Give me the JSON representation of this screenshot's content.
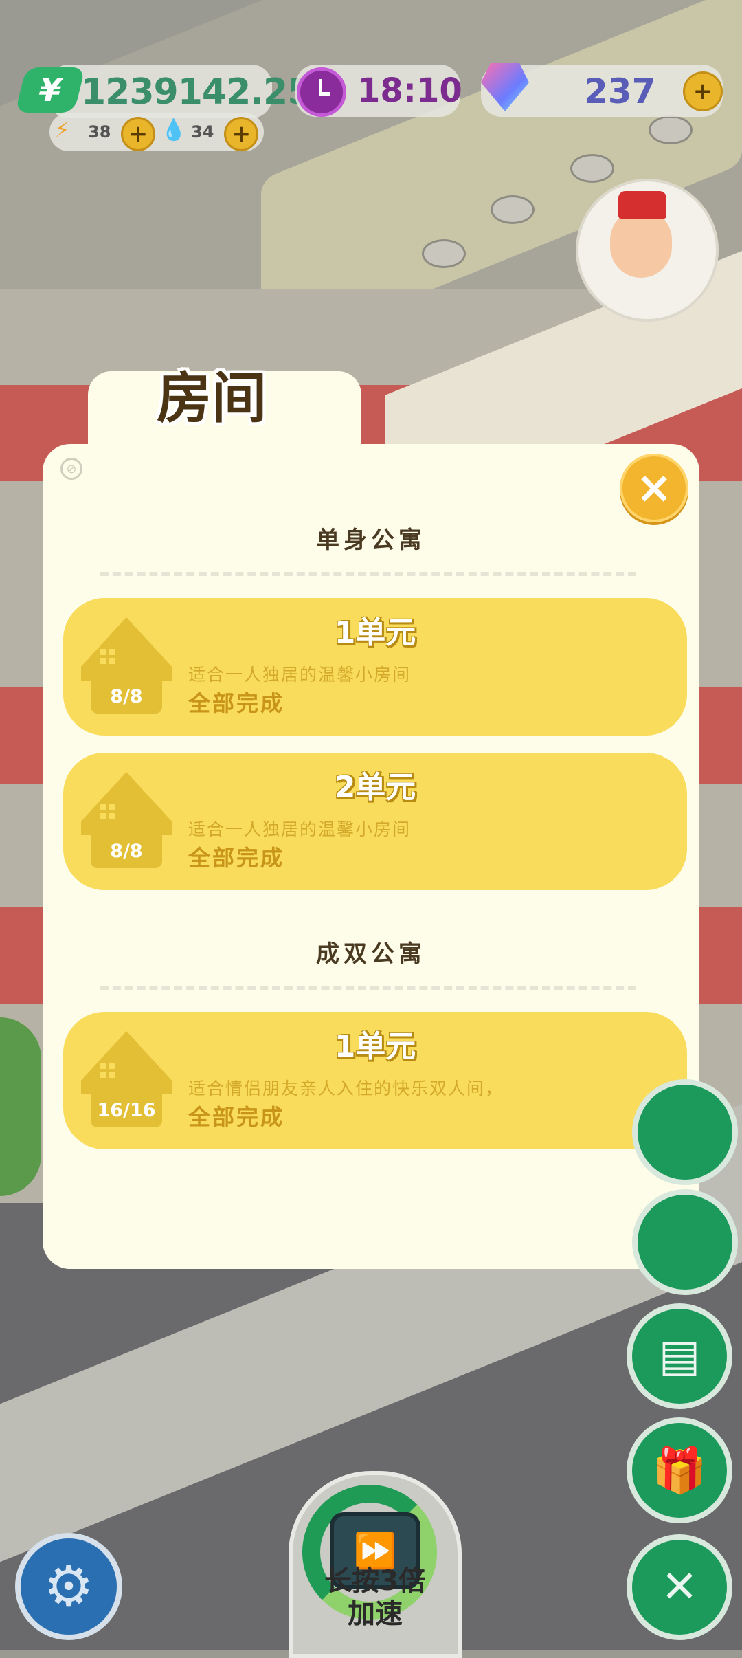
{
  "hud": {
    "money": "1239142.25",
    "money_icon": "¥",
    "energy": "38",
    "water": "34",
    "time": "18:10",
    "gems": "237"
  },
  "modal": {
    "tab_title": "房间",
    "close_icon": "×",
    "sections": [
      {
        "title": "单身公寓",
        "cards": [
          {
            "title": "1单元",
            "count": "8/8",
            "desc": "适合一人独居的温馨小房间",
            "status": "全部完成"
          },
          {
            "title": "2单元",
            "count": "8/8",
            "desc": "适合一人独居的温馨小房间",
            "status": "全部完成"
          }
        ]
      },
      {
        "title": "成双公寓",
        "cards": [
          {
            "title": "1单元",
            "count": "16/16",
            "desc": "适合情侣朋友亲人入住的快乐双人间，",
            "status": "全部完成"
          }
        ]
      }
    ]
  },
  "controls": {
    "speed_label_line1": "长按3倍",
    "speed_label_line2": "加速"
  },
  "colors": {
    "card": "#f9dc5c",
    "modal": "#fdfdea",
    "accent_green": "#1b9a5c",
    "close": "#f2b52d"
  }
}
